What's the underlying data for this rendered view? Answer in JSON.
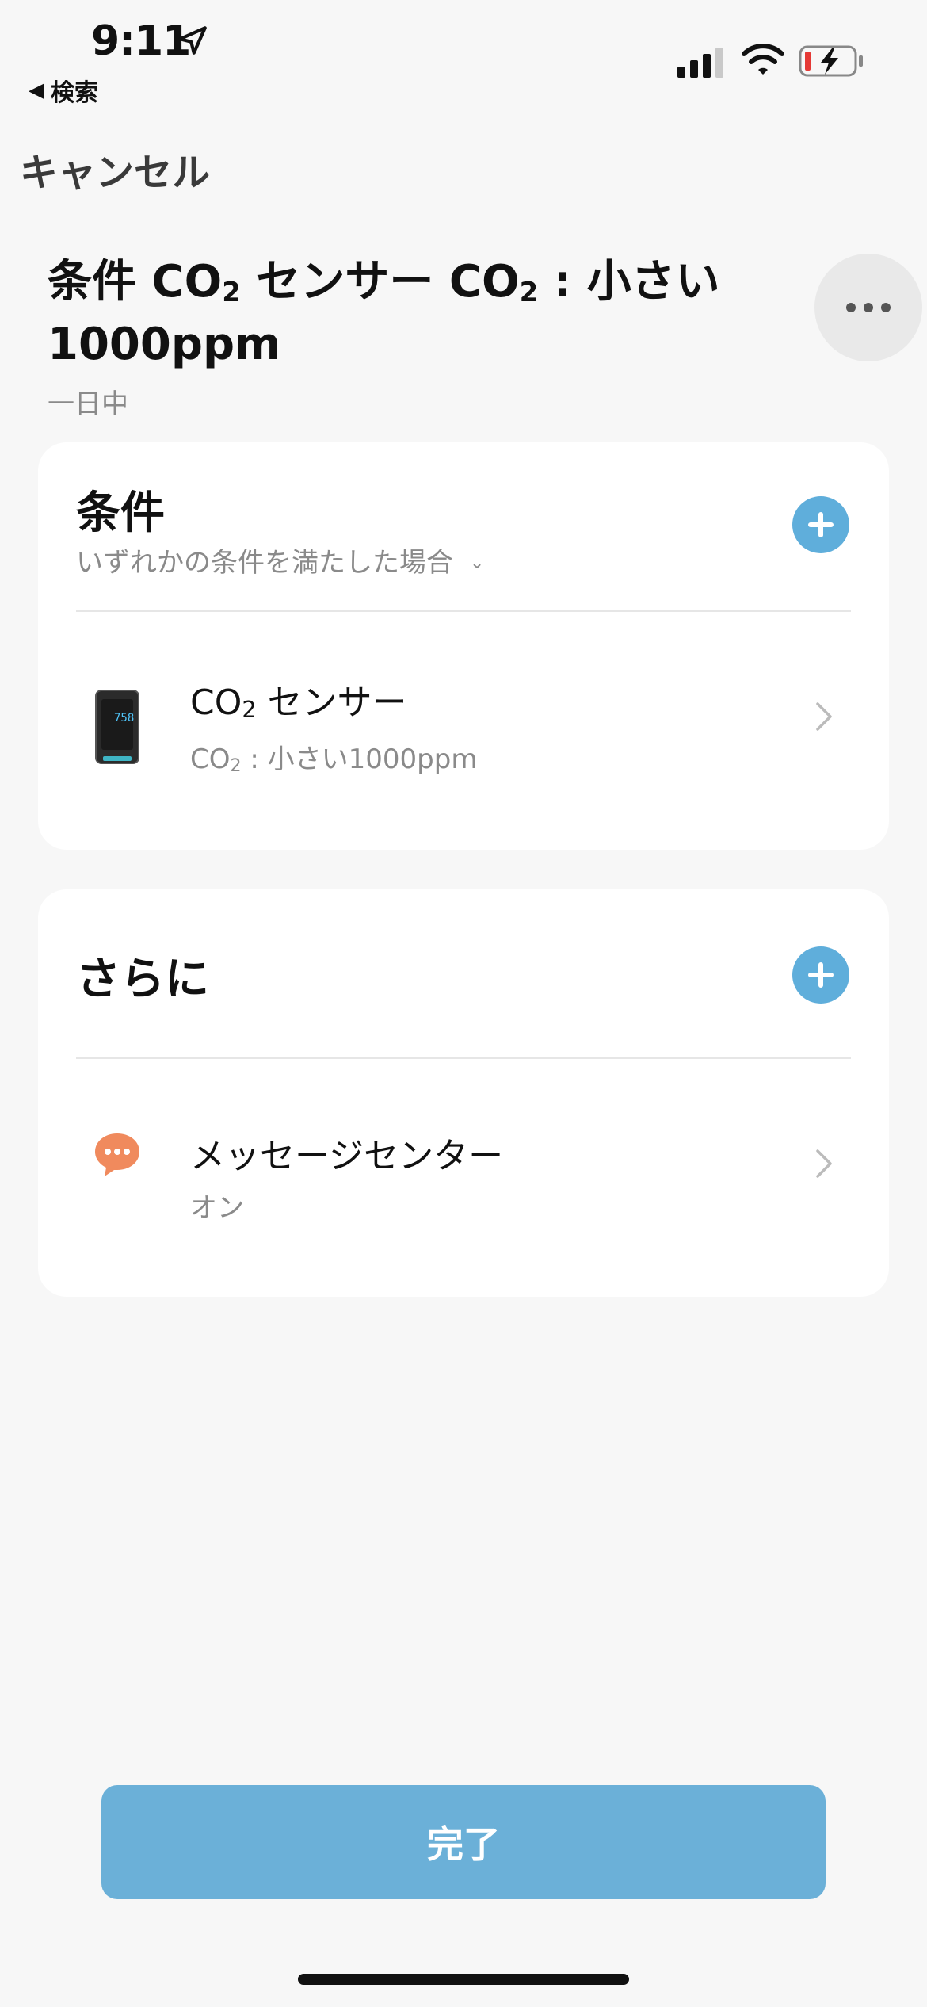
{
  "status_bar": {
    "time": "9:11",
    "back_label": "検索"
  },
  "nav": {
    "cancel_label": "キャンセル"
  },
  "header": {
    "title_part1": "条件 CO",
    "title_sub1": "2",
    "title_part2": " センサー CO",
    "title_sub2": "2",
    "title_part3": " : 小さい 1000ppm",
    "subtitle": "一日中"
  },
  "conditions": {
    "title": "条件",
    "description": "いずれかの条件を満たした場合",
    "items": [
      {
        "title_prefix": "CO",
        "title_sub": "2",
        "title_suffix": " センサー",
        "sub_prefix": "CO",
        "sub_sub": "2",
        "sub_suffix": " : 小さい1000ppm",
        "icon": "co2-sensor-device-icon",
        "device_reading": "758"
      }
    ]
  },
  "actions": {
    "title": "さらに",
    "items": [
      {
        "title": "メッセージセンター",
        "subtitle": "オン",
        "icon": "message-bubble-icon",
        "icon_color": "#f08a5d"
      }
    ]
  },
  "footer": {
    "done_label": "完了"
  },
  "colors": {
    "accent": "#5faedb",
    "done_button": "#6bb0d8",
    "background": "#f7f7f7"
  }
}
